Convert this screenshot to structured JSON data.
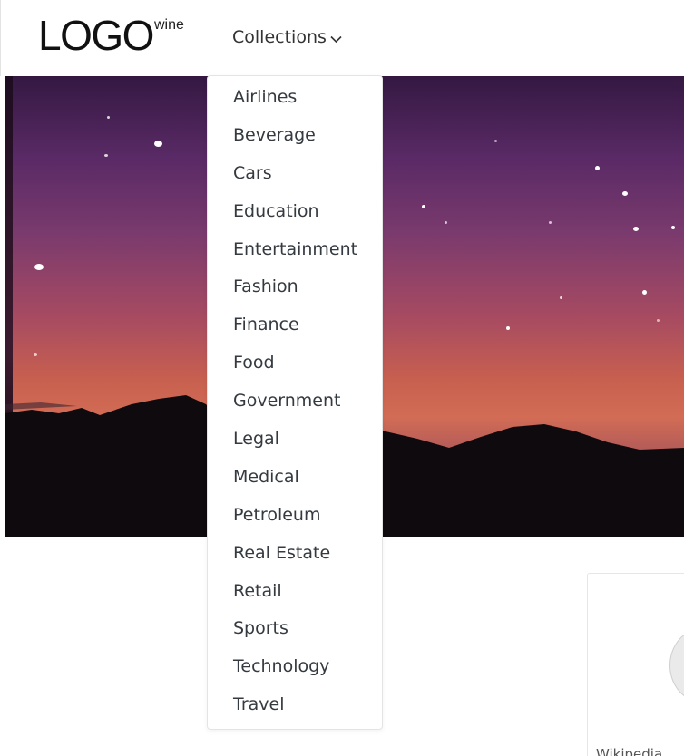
{
  "header": {
    "logo_main": "LOGO",
    "logo_sup": "wine",
    "nav_collections_label": "Collections"
  },
  "icons": {
    "collections_chevron": "chevron-down-icon"
  },
  "dropdown": {
    "items": [
      {
        "label": "Airlines"
      },
      {
        "label": "Beverage"
      },
      {
        "label": "Cars"
      },
      {
        "label": "Education"
      },
      {
        "label": "Entertainment"
      },
      {
        "label": "Fashion"
      },
      {
        "label": "Finance"
      },
      {
        "label": "Food"
      },
      {
        "label": "Government"
      },
      {
        "label": "Legal"
      },
      {
        "label": "Medical"
      },
      {
        "label": "Petroleum"
      },
      {
        "label": "Real Estate"
      },
      {
        "label": "Retail"
      },
      {
        "label": "Sports"
      },
      {
        "label": "Technology"
      },
      {
        "label": "Travel"
      }
    ]
  },
  "side_card": {
    "caption": "Wikipedia"
  },
  "colors": {
    "text": "#343a40",
    "nav_text": "#333333",
    "border": "#e4e4e4"
  }
}
